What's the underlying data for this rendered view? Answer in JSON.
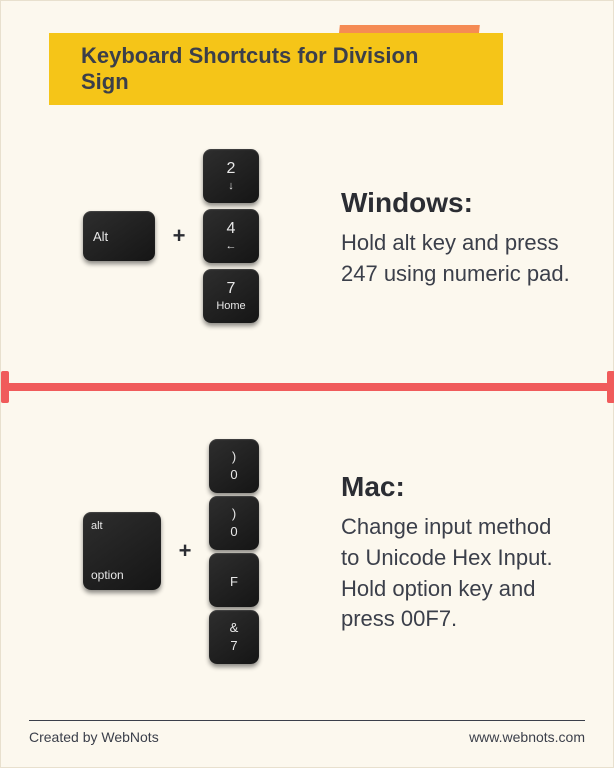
{
  "title": "Keyboard Shortcuts for Division Sign",
  "windows": {
    "heading": "Windows:",
    "description": "Hold alt key and press 247 using numeric pad.",
    "modifier_key": "Alt",
    "sequence": [
      {
        "main": "2",
        "sub_glyph": "↓"
      },
      {
        "main": "4",
        "sub_glyph": "←"
      },
      {
        "main": "7",
        "sub_text": "Home"
      }
    ]
  },
  "mac": {
    "heading": "Mac:",
    "description": "Change input method to Unicode Hex Input. Hold option key and press 00F7.",
    "modifier_key_top": "alt",
    "modifier_key_bottom": "option",
    "sequence": [
      {
        "top": ")",
        "bot": "0"
      },
      {
        "top": ")",
        "bot": "0"
      },
      {
        "top": "",
        "bot": "F"
      },
      {
        "top": "&",
        "bot": "7"
      }
    ]
  },
  "plus_glyph": "+",
  "footer": {
    "credit": "Created by WebNots",
    "site": "www.webnots.com"
  }
}
